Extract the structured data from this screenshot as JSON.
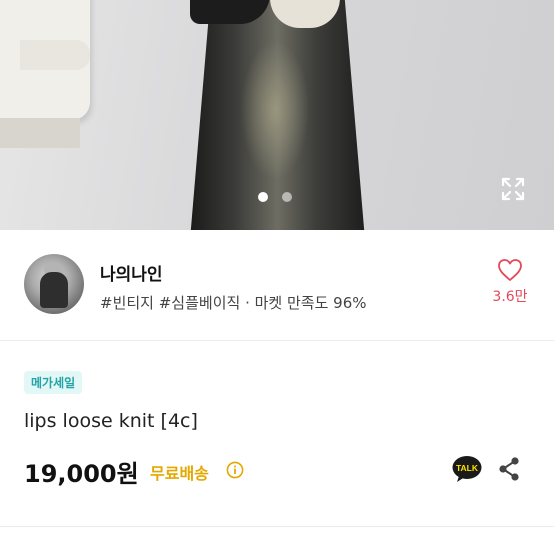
{
  "carousel": {
    "slide_count": 2,
    "active_slide": 1,
    "expand_icon": "expand-icon"
  },
  "seller": {
    "name": "나의나인",
    "tags": "#빈티지 #심플베이직 · 마켓 만족도 96%",
    "favorite_icon": "heart-icon",
    "favorite_count": "3.6만"
  },
  "product": {
    "badge": "메가세일",
    "title": "lips loose knit [4c]",
    "price": "19,000원",
    "shipping": "무료배송",
    "shipping_info_icon": "info-icon",
    "talk_icon": "talk-icon",
    "talk_label": "TALK",
    "share_icon": "share-icon"
  },
  "colors": {
    "accent_badge": "#23a4a6",
    "badge_bg": "#e3f7f6",
    "shipping": "#e5a800",
    "favorite": "#e24a5a"
  }
}
